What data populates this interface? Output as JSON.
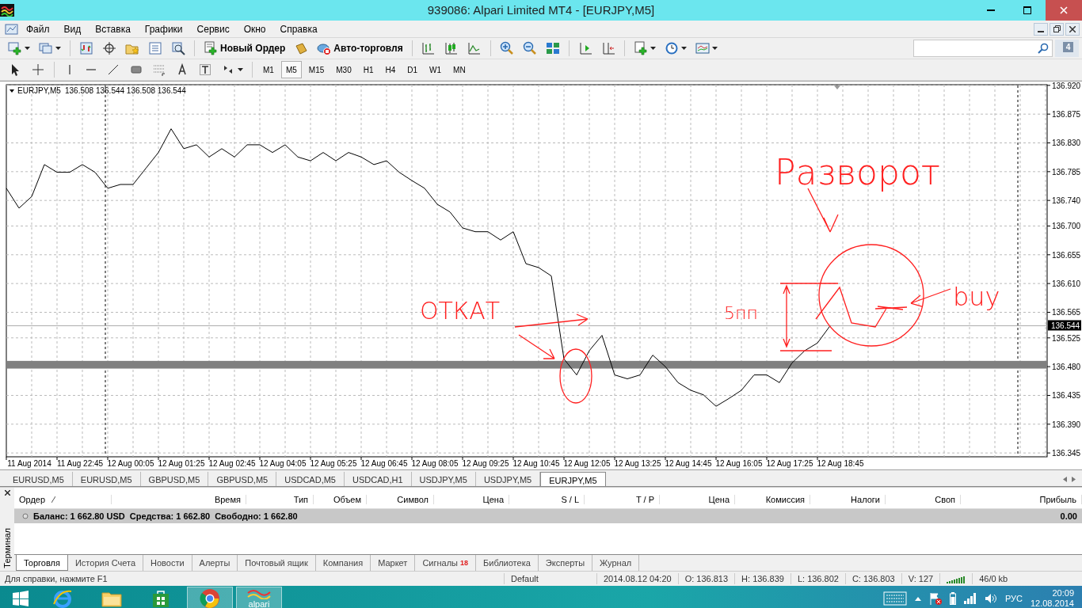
{
  "window": {
    "title": "939086: Alpari Limited MT4 - [EURJPY,M5]"
  },
  "menu": [
    "Файл",
    "Вид",
    "Вставка",
    "Графики",
    "Сервис",
    "Окно",
    "Справка"
  ],
  "toolbar": {
    "buttons": [
      "Новый Ордер",
      "Авто-торговля"
    ],
    "notifications": "4"
  },
  "timeframes": [
    {
      "label": "M1",
      "selected": false
    },
    {
      "label": "M5",
      "selected": true
    },
    {
      "label": "M15",
      "selected": false
    },
    {
      "label": "M30",
      "selected": false
    },
    {
      "label": "H1",
      "selected": false
    },
    {
      "label": "H4",
      "selected": false
    },
    {
      "label": "D1",
      "selected": false
    },
    {
      "label": "W1",
      "selected": false
    },
    {
      "label": "MN",
      "selected": false
    }
  ],
  "chart": {
    "ohlc": "136.508 136.544 136.508 136.544",
    "bid_label": "136.544",
    "chart_data": {
      "type": "line",
      "grid": true,
      "categories": [
        null,
        null,
        "11 Aug 2014",
        null,
        null,
        null,
        "11 Aug 22:45",
        null,
        null,
        null,
        "12 Aug 00:05",
        null,
        null,
        null,
        "12 Aug 01:25",
        null,
        null,
        null,
        "12 Aug 02:45",
        null,
        null,
        null,
        "12 Aug 04:05",
        null,
        null,
        null,
        "12 Aug 05:25",
        null,
        null,
        null,
        "12 Aug 06:45",
        null,
        null,
        null,
        "12 Aug 08:05",
        null,
        null,
        null,
        "12 Aug 09:25",
        null,
        null,
        null,
        "12 Aug 10:45",
        null,
        null,
        null,
        "12 Aug 12:05",
        null,
        null,
        null,
        "12 Aug 13:25",
        null,
        null,
        null,
        "12 Aug 14:45",
        null,
        null,
        null,
        "12 Aug 16:05",
        null,
        null,
        null,
        "12 Aug 17:25",
        null,
        null,
        null,
        "12 Aug 18:45"
      ],
      "ylim": [
        136.339,
        136.921
      ],
      "series": [
        {
          "name": "EURJPY,M5",
          "color": "#000000",
          "values": [
            136.759,
            136.728,
            136.746,
            136.796,
            136.784,
            136.784,
            136.796,
            136.784,
            136.759,
            136.765,
            136.765,
            136.79,
            136.815,
            136.852,
            136.821,
            136.827,
            136.808,
            136.821,
            136.808,
            136.827,
            136.827,
            136.815,
            136.827,
            136.808,
            136.802,
            136.815,
            136.802,
            136.815,
            136.808,
            136.796,
            136.802,
            136.784,
            136.771,
            136.759,
            136.734,
            136.722,
            136.697,
            136.691,
            136.691,
            136.678,
            136.691,
            136.641,
            136.635,
            136.622,
            136.492,
            136.467,
            136.505,
            136.529,
            136.467,
            136.461,
            136.467,
            136.498,
            136.48,
            136.455,
            136.443,
            136.436,
            136.418,
            136.43,
            136.443,
            136.467,
            136.467,
            136.455,
            136.486,
            136.505,
            136.517,
            136.544,
            null
          ]
        }
      ],
      "yticks": [
        {
          "value": 136.92,
          "label": "136.920"
        },
        {
          "value": 136.875,
          "label": "136.875"
        },
        {
          "value": 136.83,
          "label": "136.830"
        },
        {
          "value": 136.785,
          "label": "136.785"
        },
        {
          "value": 136.74,
          "label": "136.740"
        },
        {
          "value": 136.7,
          "label": "136.700"
        },
        {
          "value": 136.655,
          "label": "136.655"
        },
        {
          "value": 136.61,
          "label": "136.610"
        },
        {
          "value": 136.565,
          "label": "136.565"
        },
        {
          "value": 136.525,
          "label": "136.525"
        },
        {
          "value": 136.48,
          "label": "136.480"
        },
        {
          "value": 136.435,
          "label": "136.435"
        },
        {
          "value": 136.39,
          "label": "136.390"
        },
        {
          "value": 136.345,
          "label": "136.345"
        }
      ],
      "bands": [
        {
          "axis": "y",
          "from": 136.477,
          "to": 136.489
        }
      ],
      "ref_lines": [
        {
          "axis": "y",
          "value": 136.544
        }
      ],
      "annotations": [
        {
          "text": "Разворот"
        },
        {
          "text": "ОТКАТ"
        },
        {
          "text": "5пп"
        },
        {
          "text": "buy"
        }
      ]
    }
  },
  "chart_tabs": [
    {
      "label": "EURUSD,M5",
      "selected": false
    },
    {
      "label": "EURUSD,M5",
      "selected": false
    },
    {
      "label": "GBPUSD,M5",
      "selected": false
    },
    {
      "label": "GBPUSD,M5",
      "selected": false
    },
    {
      "label": "USDCAD,M5",
      "selected": false
    },
    {
      "label": "USDCAD,H1",
      "selected": false
    },
    {
      "label": "USDJPY,M5",
      "selected": false
    },
    {
      "label": "USDJPY,M5",
      "selected": false
    },
    {
      "label": "EURJPY,M5",
      "selected": true
    }
  ],
  "terminal": {
    "title": "Терминал",
    "columns": [
      "Ордер",
      "Время",
      "Тип",
      "Объем",
      "Символ",
      "Цена",
      "S / L",
      "T / P",
      "Цена",
      "Комиссия",
      "Налоги",
      "Своп",
      "Прибыль"
    ],
    "balance": [
      "Баланс: 1 662.80 USD",
      "Средства: 1 662.80",
      "Свободно: 1 662.80"
    ],
    "profit": "0.00",
    "tabs": [
      {
        "label": "Торговля",
        "selected": true
      },
      {
        "label": "История Счета",
        "selected": false
      },
      {
        "label": "Новости",
        "selected": false
      },
      {
        "label": "Алерты",
        "selected": false
      },
      {
        "label": "Почтовый ящик",
        "selected": false
      },
      {
        "label": "Компания",
        "selected": false
      },
      {
        "label": "Маркет",
        "selected": false
      },
      {
        "label": "Сигналы",
        "badge": "18",
        "selected": false
      },
      {
        "label": "Библиотека",
        "selected": false
      },
      {
        "label": "Эксперты",
        "selected": false
      },
      {
        "label": "Журнал",
        "selected": false
      }
    ]
  },
  "status_bar": {
    "help": "Для справки, нажмите F1",
    "profile": "Default",
    "fields": [
      "2014.08.12 04:20",
      "O: 136.813",
      "H: 136.839",
      "L: 136.802",
      "C: 136.803",
      "V: 127"
    ],
    "traffic": "46/0 kb"
  },
  "taskbar": {
    "apps": [
      {
        "kind": "browser",
        "active": false
      },
      {
        "kind": "folder",
        "active": false
      },
      {
        "kind": "store",
        "active": false
      },
      {
        "kind": "round-browser",
        "active": true
      },
      {
        "kind": "alpari",
        "label": "alpari",
        "active": true
      }
    ],
    "language": "РУС",
    "time": "20:09",
    "date": "12.08.2014"
  }
}
